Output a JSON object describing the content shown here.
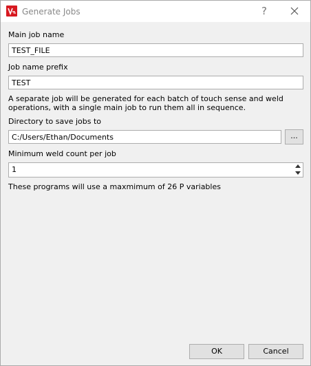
{
  "window": {
    "title": "Generate Jobs",
    "help_glyph": "?",
    "accent_color": "#d71920"
  },
  "form": {
    "main_job_name_label": "Main job name",
    "main_job_name_value": "TEST_FILE",
    "prefix_label": "Job name prefix",
    "prefix_value": "TEST",
    "info_text": "A separate job will be generated for each batch of touch sense and weld operations, with a single main job to run them all in sequence.",
    "directory_label": "Directory to save jobs to",
    "directory_value": "C:/Users/Ethan/Documents",
    "browse_label": "...",
    "min_weld_label": "Minimum weld count per job",
    "min_weld_value": "1",
    "p_vars_note": "These programs will use a maxmimum of 26 P variables"
  },
  "buttons": {
    "ok_label": "OK",
    "cancel_label": "Cancel"
  }
}
